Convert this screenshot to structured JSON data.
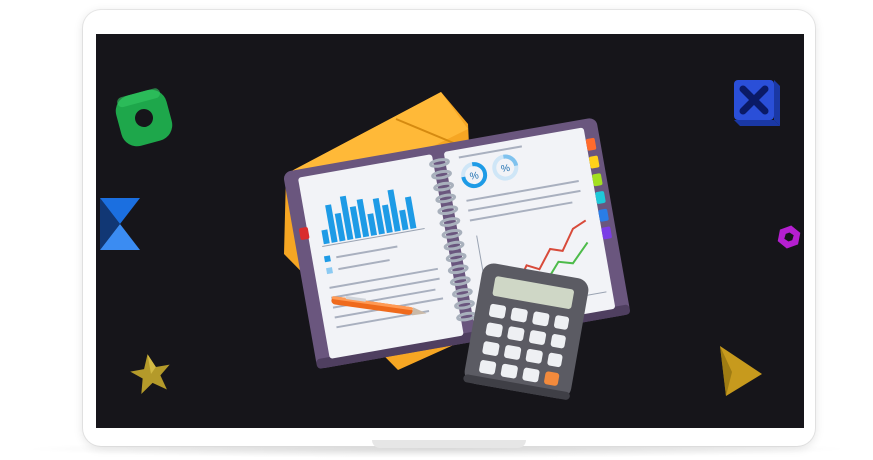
{
  "illustration": {
    "subject": "notebook-with-charts-and-calculator",
    "percent_badges": [
      "%",
      "%"
    ],
    "colors": {
      "screen_bg": "#16151a",
      "frame": "#ffffff",
      "folder": "#f6a623",
      "notebook_cover": "#6a567e",
      "page": "#f2f3f7",
      "bar_chart": "#1e9be6",
      "calculator_body": "#5b5b63",
      "calculator_accent": "#f28a3c",
      "pen": "#ef6a1c"
    },
    "decorations": [
      {
        "shape": "rounded-square-ring",
        "color": "#1ea74b"
      },
      {
        "shape": "bowtie",
        "color": "#1b6fe0"
      },
      {
        "shape": "star",
        "color": "#b49a2a"
      },
      {
        "shape": "x-cube",
        "color": "#2a4fd8"
      },
      {
        "shape": "hexagon-ring",
        "color": "#b51fd0"
      },
      {
        "shape": "triangle",
        "color": "#c79a1d"
      }
    ],
    "tab_colors": [
      "#ff6b2c",
      "#ffd21a",
      "#a3e021",
      "#1ec9d9",
      "#2a7de6",
      "#7a3de6",
      "#d92c2c"
    ]
  }
}
